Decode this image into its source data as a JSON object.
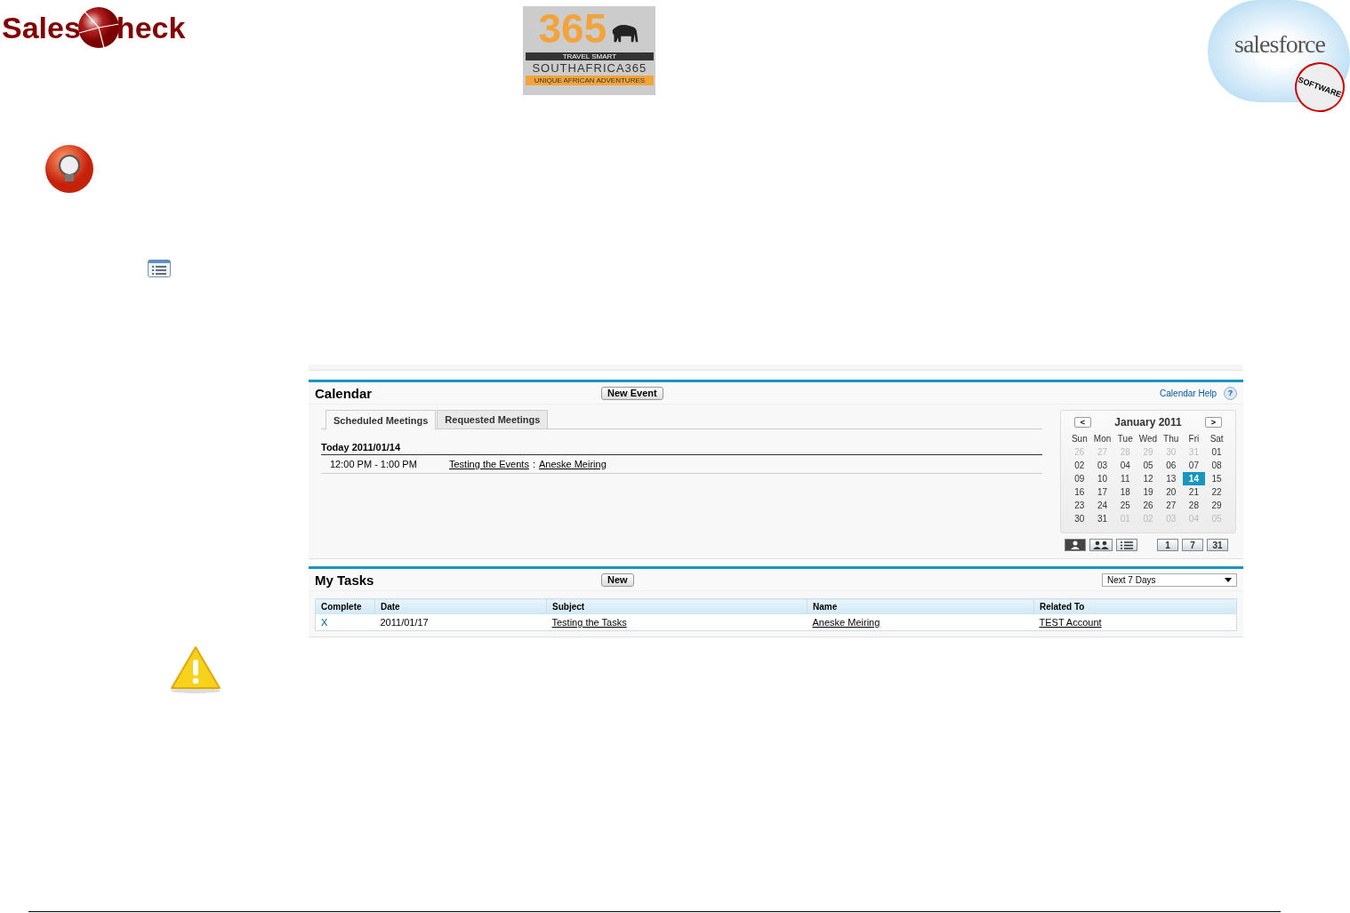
{
  "header": {
    "saleslogo": {
      "left": "Sales",
      "right": "heck"
    },
    "travel_logo": {
      "number": "365",
      "tagline": "TRAVEL SMART",
      "name": "SOUTHAFRICA365",
      "slogan": "UNIQUE AFRICAN ADVENTURES"
    },
    "cloud_logo": {
      "word": "salesforce",
      "badge": "SOFTWARE"
    }
  },
  "calendar": {
    "title": "Calendar",
    "new_button": "New Event",
    "help_link": "Calendar Help",
    "help_icon": "?",
    "tabs": [
      {
        "label": "Scheduled Meetings",
        "selected": true
      },
      {
        "label": "Requested Meetings",
        "selected": false
      }
    ],
    "day_heading": "Today 2011/01/14",
    "events": [
      {
        "time": "12:00 PM - 1:00 PM",
        "subject": "Testing the Events",
        "separator": ":",
        "name": "Aneske Meiring"
      }
    ],
    "mini": {
      "month": "January 2011",
      "prev": "<",
      "next": ">",
      "weekdays": [
        "Sun",
        "Mon",
        "Tue",
        "Wed",
        "Thu",
        "Fri",
        "Sat"
      ],
      "days": [
        {
          "label": "26",
          "in_month": false,
          "selected": false
        },
        {
          "label": "27",
          "in_month": false,
          "selected": false
        },
        {
          "label": "28",
          "in_month": false,
          "selected": false
        },
        {
          "label": "29",
          "in_month": false,
          "selected": false
        },
        {
          "label": "30",
          "in_month": false,
          "selected": false
        },
        {
          "label": "31",
          "in_month": false,
          "selected": false
        },
        {
          "label": "01",
          "in_month": true,
          "selected": false
        },
        {
          "label": "02",
          "in_month": true,
          "selected": false
        },
        {
          "label": "03",
          "in_month": true,
          "selected": false
        },
        {
          "label": "04",
          "in_month": true,
          "selected": false
        },
        {
          "label": "05",
          "in_month": true,
          "selected": false
        },
        {
          "label": "06",
          "in_month": true,
          "selected": false
        },
        {
          "label": "07",
          "in_month": true,
          "selected": false
        },
        {
          "label": "08",
          "in_month": true,
          "selected": false
        },
        {
          "label": "09",
          "in_month": true,
          "selected": false
        },
        {
          "label": "10",
          "in_month": true,
          "selected": false
        },
        {
          "label": "11",
          "in_month": true,
          "selected": false
        },
        {
          "label": "12",
          "in_month": true,
          "selected": false
        },
        {
          "label": "13",
          "in_month": true,
          "selected": false
        },
        {
          "label": "14",
          "in_month": true,
          "selected": true
        },
        {
          "label": "15",
          "in_month": true,
          "selected": false
        },
        {
          "label": "16",
          "in_month": true,
          "selected": false
        },
        {
          "label": "17",
          "in_month": true,
          "selected": false
        },
        {
          "label": "18",
          "in_month": true,
          "selected": false
        },
        {
          "label": "19",
          "in_month": true,
          "selected": false
        },
        {
          "label": "20",
          "in_month": true,
          "selected": false
        },
        {
          "label": "21",
          "in_month": true,
          "selected": false
        },
        {
          "label": "22",
          "in_month": true,
          "selected": false
        },
        {
          "label": "23",
          "in_month": true,
          "selected": false
        },
        {
          "label": "24",
          "in_month": true,
          "selected": false
        },
        {
          "label": "25",
          "in_month": true,
          "selected": false
        },
        {
          "label": "26",
          "in_month": true,
          "selected": false
        },
        {
          "label": "27",
          "in_month": true,
          "selected": false
        },
        {
          "label": "28",
          "in_month": true,
          "selected": false
        },
        {
          "label": "29",
          "in_month": true,
          "selected": false
        },
        {
          "label": "30",
          "in_month": true,
          "selected": false
        },
        {
          "label": "31",
          "in_month": true,
          "selected": false
        },
        {
          "label": "01",
          "in_month": false,
          "selected": false
        },
        {
          "label": "02",
          "in_month": false,
          "selected": false
        },
        {
          "label": "03",
          "in_month": false,
          "selected": false
        },
        {
          "label": "04",
          "in_month": false,
          "selected": false
        },
        {
          "label": "05",
          "in_month": false,
          "selected": false
        }
      ]
    },
    "view_buttons": [
      {
        "kind": "person",
        "selected": true
      },
      {
        "kind": "people",
        "selected": false
      },
      {
        "kind": "list",
        "selected": false
      }
    ],
    "range_buttons": [
      {
        "label": "1",
        "selected": false
      },
      {
        "label": "7",
        "selected": false
      },
      {
        "label": "31",
        "selected": false
      }
    ]
  },
  "tasks": {
    "title": "My Tasks",
    "new_button": "New",
    "filter": "Next 7 Days",
    "columns": [
      "Complete",
      "Date",
      "Subject",
      "Name",
      "Related To"
    ],
    "rows": [
      {
        "complete": "X",
        "date": "2011/01/17",
        "subject": "Testing the Tasks",
        "name": "Aneske Meiring",
        "related_to": "TEST Account"
      }
    ]
  }
}
